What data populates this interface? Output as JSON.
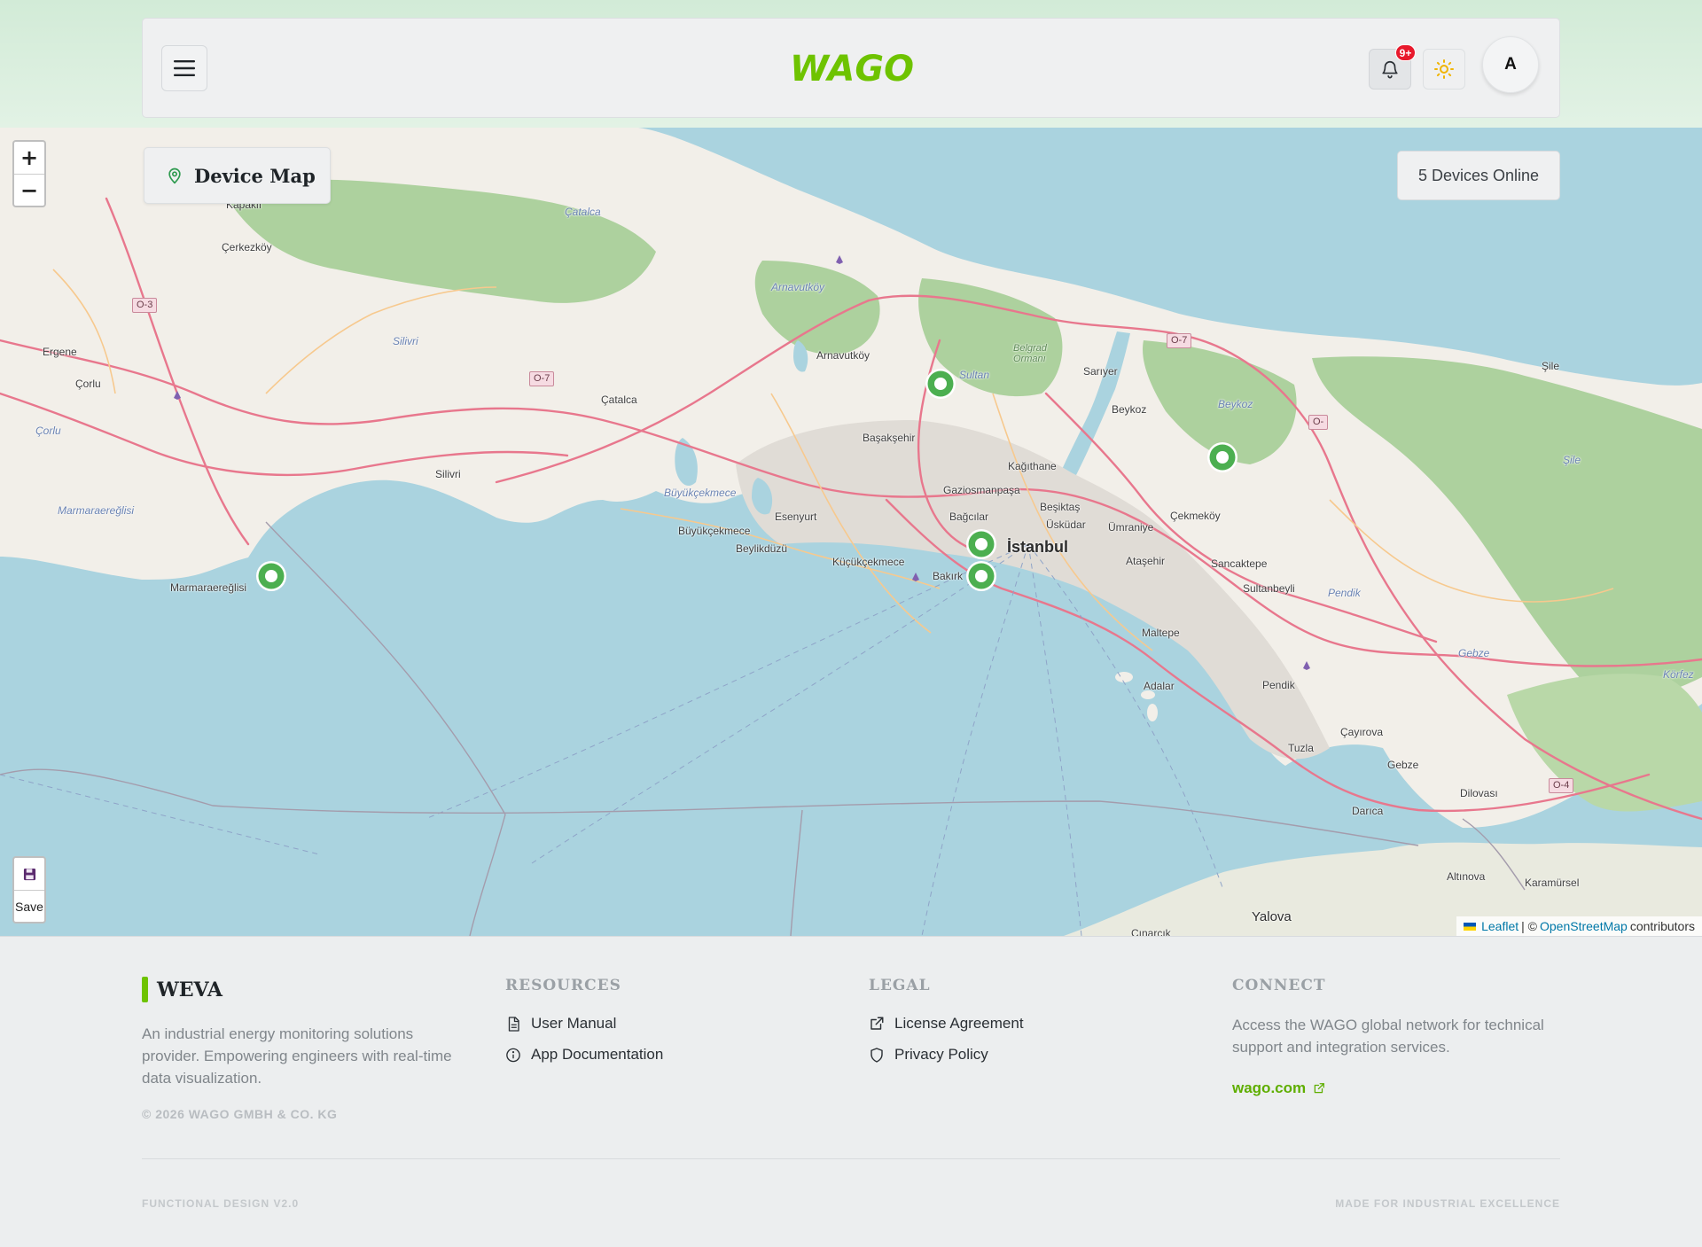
{
  "header": {
    "logo_text": "WAGO",
    "notification_badge": "9+",
    "avatar_initial": "A"
  },
  "map": {
    "title": "Device Map",
    "devices_online": "5 Devices Online",
    "zoom_in": "+",
    "zoom_out": "−",
    "save_label": "Save",
    "attribution": {
      "leaflet": "Leaflet",
      "separator": "| ©",
      "osm": "OpenStreetMap",
      "contributors": "contributors"
    },
    "labels": {
      "istanbul": "İstanbul",
      "kapakli": "Kapaklı",
      "cerkezkoy": "Çerkezköy",
      "ergene": "Ergene",
      "corlu": "Çorlu",
      "corlu_river": "Çorlu",
      "marmaraereglisi_area": "Marmaraereğlisi",
      "marmaraereglisi": "Marmaraereğlisi",
      "silivri_area": "Silivri",
      "silivri": "Silivri",
      "catalca_area": "Çatalca",
      "catalca": "Çatalca",
      "arnavutkoy_area": "Arnavutköy",
      "arnavutkoy": "Arnavutköy",
      "sultan": "Sultan",
      "belgrad": "Belgrad\nOrmanı",
      "sariyer": "Sarıyer",
      "beykoz": "Beykoz",
      "beykoz_area": "Beykoz",
      "sile": "Şile",
      "sile_area": "Şile",
      "basaksehir": "Başakşehir",
      "kagithane": "Kağıthane",
      "gaziosmanpasa": "Gaziosmanpaşa",
      "besiktas": "Beşiktaş",
      "uskudar": "Üsküdar",
      "bagcilar": "Bağcılar",
      "umraniye": "Ümraniye",
      "cekmekoy": "Çekmeköy",
      "esenyurt": "Esenyurt",
      "buyukcekmece_lake": "Büyükçekmece",
      "buyukcekmece": "Büyükçekmece",
      "beylikduzu": "Beylikdüzü",
      "kucukcekmece": "Küçükçekmece",
      "bakirkoy": "Bakırk",
      "atasehir": "Ataşehir",
      "sancaktepe": "Sancaktepe",
      "sultanbeyli": "Sultanbeyli",
      "pendik_area": "Pendik",
      "pendik": "Pendik",
      "maltepe": "Maltepe",
      "adalar": "Adalar",
      "tuzla": "Tuzla",
      "cayirova": "Çayırova",
      "gebze": "Gebze",
      "gebze_area": "Gebze",
      "korfez": "Körfez",
      "darica": "Darıca",
      "dilovasi": "Dilovası",
      "altinova": "Altınova",
      "karamursel": "Karamürsel",
      "yalova": "Yalova",
      "cinarcik": "Çınarcık"
    },
    "shields": {
      "o3": "O-3",
      "o7_west": "O-7",
      "o7_east": "O-7",
      "o_cut": "O-",
      "o4": "O-4"
    },
    "colors": {
      "sea": "#aad3df",
      "land": "#f2efe9",
      "forest": "#add19e",
      "urban": "#e0dcd6",
      "marker": "#4caf50",
      "accent": "#6ec300"
    }
  },
  "footer": {
    "brand": "WEVA",
    "description": "An industrial energy monitoring solutions provider. Empowering engineers with real-time data visualization.",
    "copyright": "© 2026 WAGO GMBH & CO. KG",
    "resources": {
      "heading": "RESOURCES",
      "links": [
        "User Manual",
        "App Documentation"
      ]
    },
    "legal": {
      "heading": "LEGAL",
      "links": [
        "License Agreement",
        "Privacy Policy"
      ]
    },
    "connect": {
      "heading": "CONNECT",
      "description": "Access the WAGO global network for technical support and integration services.",
      "link": "wago.com"
    },
    "bottom_left": "FUNCTIONAL DESIGN V2.0",
    "bottom_right": "MADE FOR INDUSTRIAL EXCELLENCE"
  },
  "icons": {
    "menu": "menu-icon",
    "bell": "bell-icon",
    "sun": "sun-icon",
    "map_pin": "map-pin-icon",
    "save": "floppy-disk-icon",
    "document": "document-icon",
    "info": "info-icon",
    "external_link": "external-link-icon",
    "shield": "shield-icon"
  }
}
